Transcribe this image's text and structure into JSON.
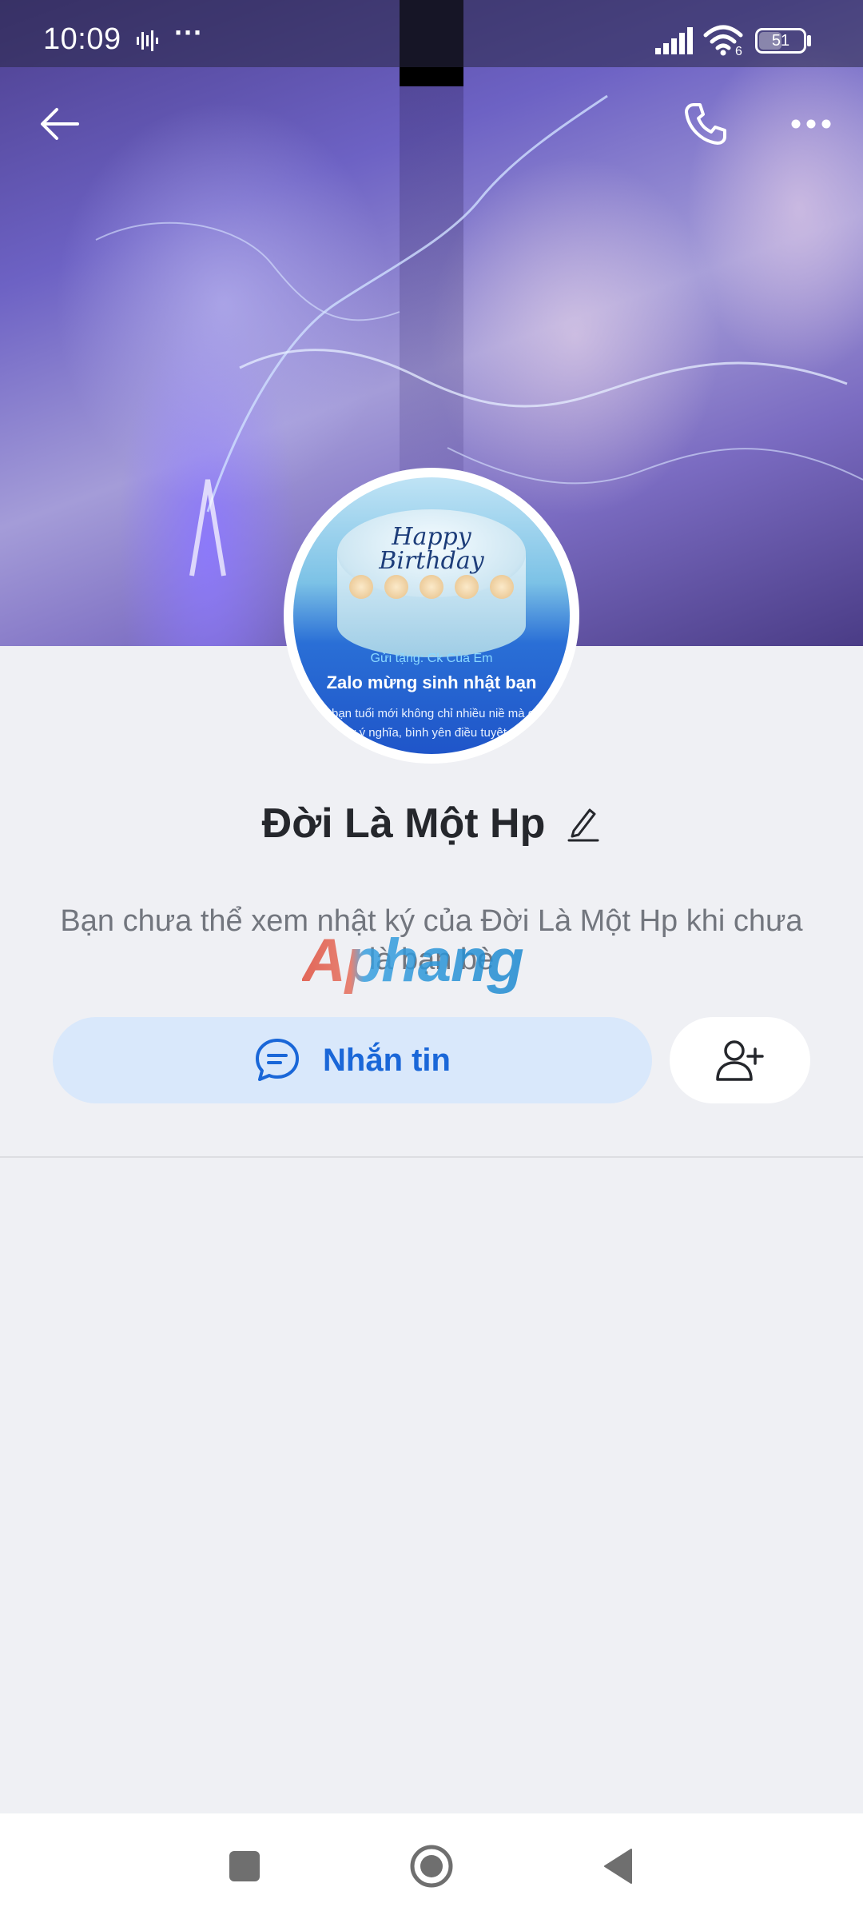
{
  "status_bar": {
    "time": "10:09",
    "wifi_badge": "6",
    "battery": "51",
    "battery_level": 0.51
  },
  "avatar": {
    "cake_text_line1": "Happy",
    "cake_text_line2": "Birthday",
    "gift_from": "Gửi tặng: Ck Của Em",
    "gift_title": "Zalo mừng sinh nhật bạn",
    "gift_body": "úc bạn tuổi mới không chỉ nhiều niề mà còn đầy ý nghĩa, bình yên điều tuyệt vời"
  },
  "profile": {
    "name": "Đời Là Một Hp",
    "privacy_note": "Bạn chưa thể xem nhật ký của Đời Là Một Hp khi chưa là bạn bè"
  },
  "actions": {
    "message_label": "Nhắn tin"
  },
  "watermark": "Aphang",
  "colors": {
    "accent": "#1a67d8",
    "message_button_bg": "#d9e8fb",
    "page_bg": "#eff0f4"
  },
  "icons": {
    "back": "arrow-left-icon",
    "call": "phone-icon",
    "more": "more-horizontal-icon",
    "edit": "pencil-icon",
    "message": "chat-bubble-icon",
    "add_friend": "user-plus-icon"
  }
}
